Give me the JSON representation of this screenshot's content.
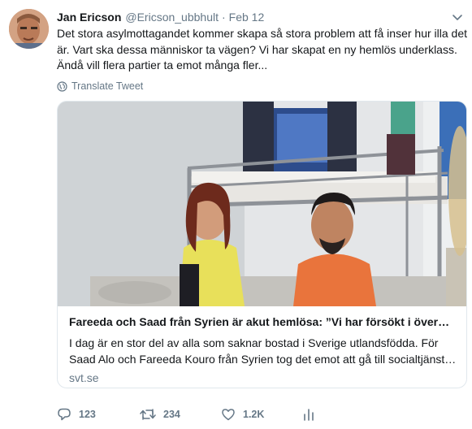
{
  "tweet": {
    "author_name": "Jan Ericson",
    "author_handle": "@Ericson_ubbhult",
    "separator": "·",
    "time": "Feb 12",
    "text": "Det stora asylmottagandet kommer skapa så stora problem att få inser hur illa det är. Vart ska dessa människor ta vägen? Vi har skapat en ny hemlös underklass. Ändå vill flera partier ta emot många fler...",
    "translate_label": "Translate Tweet"
  },
  "card": {
    "title": "Fareeda och Saad från Syrien är akut hemlösa: ”Vi har försökt i över…",
    "description": "I dag är en stor del av alla som saknar bostad i Sverige utlandsfödda. För Saad Alo och Fareeda Kouro från Syrien tog det emot att gå till socialtjänst…",
    "domain": "svt.se"
  },
  "actions": {
    "replies": "123",
    "retweets": "234",
    "likes": "1.2K"
  },
  "icons": {
    "avatar": "avatar-photo",
    "chevron": "chevron-down-icon",
    "globe": "globe-icon",
    "reply": "reply-icon",
    "retweet": "retweet-icon",
    "like": "heart-icon",
    "analytics": "analytics-icon"
  },
  "colors": {
    "text": "#14171a",
    "secondary": "#657786",
    "border": "#e1e8ed"
  }
}
